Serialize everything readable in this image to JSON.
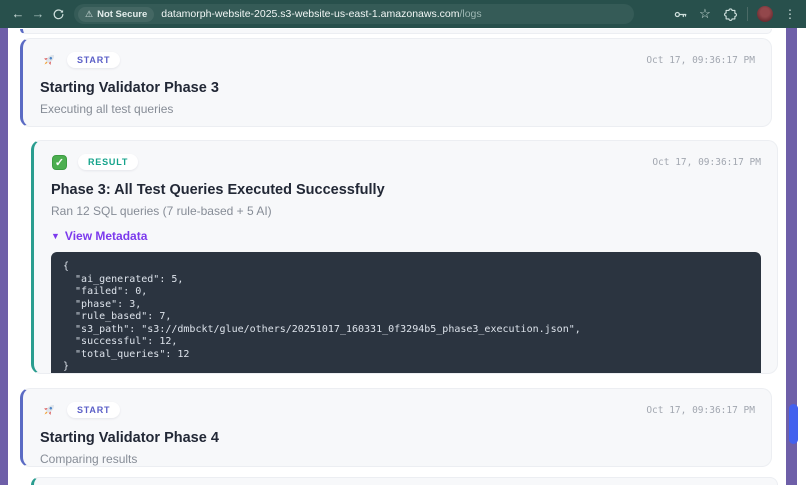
{
  "browser": {
    "back_icon": "←",
    "forward_icon": "→",
    "security_label": "Not Secure",
    "warning_icon": "⚠",
    "url_host": "datamorph-website-2025.s3-website-us-east-1.amazonaws.com",
    "url_path": "/logs",
    "star_icon": "☆",
    "menu_icon": "⋮"
  },
  "colors": {
    "chrome_background": "#28504c",
    "page_accent_purple": "#6e5fa8",
    "scroll_thumb_blue": "#4361ee",
    "start_accent": "#5b6bc4",
    "result_accent": "#2a9d8f",
    "metadata_link_purple": "#7c3aed",
    "code_background": "#2b3440"
  },
  "logs": [
    {
      "badge": "START",
      "title": "Starting Validator Phase 3",
      "subtitle": "Executing all test queries",
      "timestamp": "Oct 17, 09:36:17 PM"
    },
    {
      "badge": "RESULT",
      "check_glyph": "✓",
      "title": "Phase 3: All Test Queries Executed Successfully",
      "subtitle": "Ran 12 SQL queries (7 rule-based + 5 AI)",
      "timestamp": "Oct 17, 09:36:17 PM",
      "metadata_toggle_icon": "▼",
      "metadata_toggle_label": "View Metadata",
      "metadata_json": "{\n  \"ai_generated\": 5,\n  \"failed\": 0,\n  \"phase\": 3,\n  \"rule_based\": 7,\n  \"s3_path\": \"s3://dmbckt/glue/others/20251017_160331_0f3294b5_phase3_execution.json\",\n  \"successful\": 12,\n  \"total_queries\": 12\n}"
    },
    {
      "badge": "START",
      "title": "Starting Validator Phase 4",
      "subtitle": "Comparing results",
      "timestamp": "Oct 17, 09:36:17 PM"
    }
  ]
}
